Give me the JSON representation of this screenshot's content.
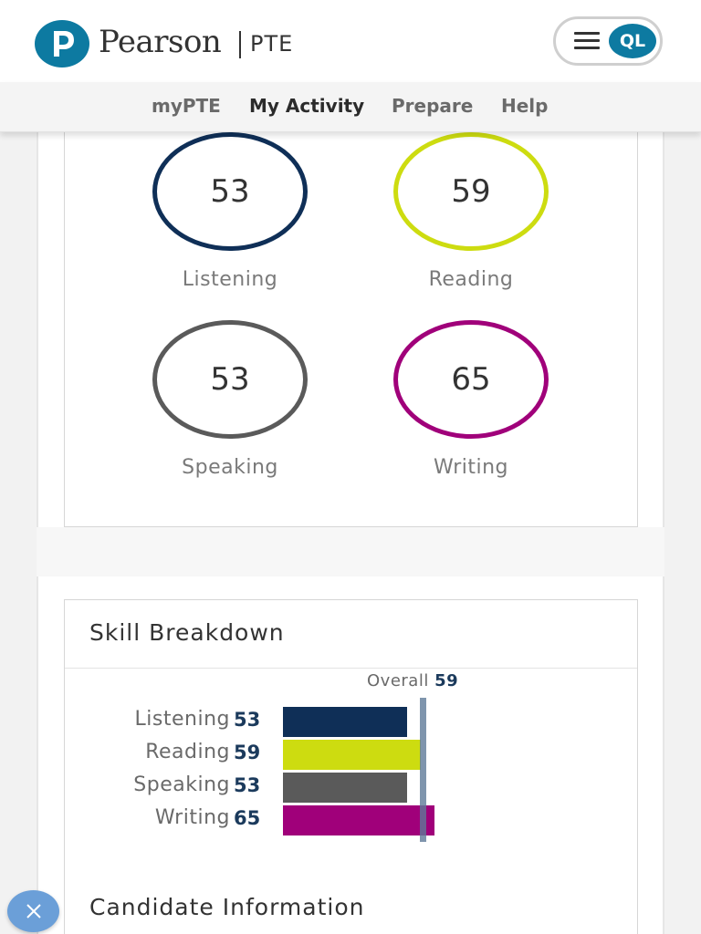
{
  "header": {
    "brand": "Pearson",
    "product": "PTE",
    "avatar_initials": "QL"
  },
  "nav": {
    "items": [
      {
        "label": "myPTE"
      },
      {
        "label": "My Activity"
      },
      {
        "label": "Prepare"
      },
      {
        "label": "Help"
      }
    ],
    "active": "My Activity"
  },
  "scores": [
    {
      "skill": "Listening",
      "score": "53",
      "color": "#0f2f57"
    },
    {
      "skill": "Reading",
      "score": "59",
      "color": "#cddc10"
    },
    {
      "skill": "Speaking",
      "score": "53",
      "color": "#5a5a5a"
    },
    {
      "skill": "Writing",
      "score": "65",
      "color": "#a0007a"
    }
  ],
  "skill_breakdown": {
    "title": "Skill Breakdown",
    "overall_label": "Overall",
    "overall_value": "59",
    "overall_numeric": 59,
    "bars": [
      {
        "label": "Listening",
        "value": "53",
        "numeric": 53,
        "color": "#0f2f57"
      },
      {
        "label": "Reading",
        "value": "59",
        "numeric": 59,
        "color": "#cddc10"
      },
      {
        "label": "Speaking",
        "value": "53",
        "numeric": 53,
        "color": "#5a5a5a"
      },
      {
        "label": "Writing",
        "value": "65",
        "numeric": 65,
        "color": "#a0007a"
      }
    ]
  },
  "candidate_information": {
    "title": "Candidate Information"
  },
  "icons": {
    "menu": "hamburger-icon",
    "close": "close-icon",
    "logo": "pearson-logo-icon"
  }
}
